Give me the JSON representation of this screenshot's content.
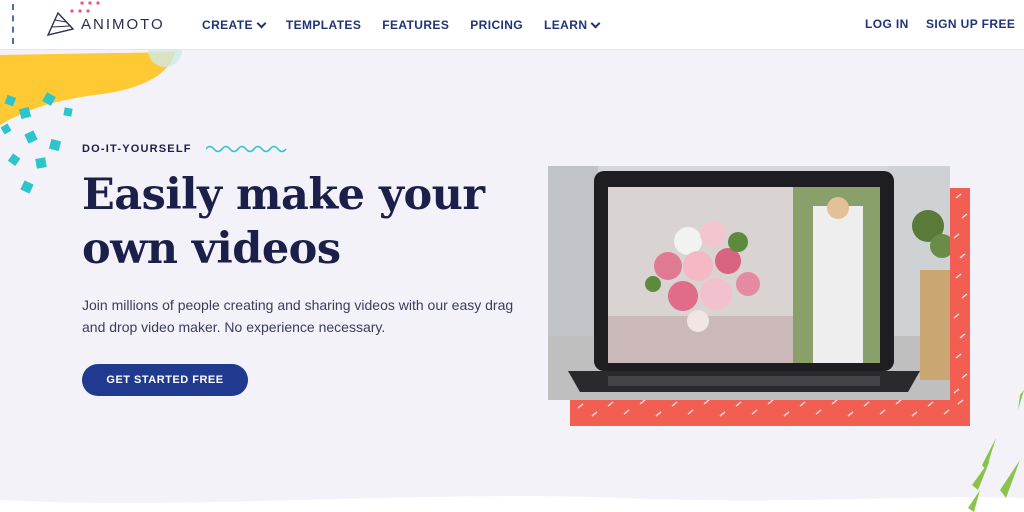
{
  "nav": {
    "logo": "ANIMOTO",
    "links": [
      {
        "label": "CREATE",
        "dropdown": true
      },
      {
        "label": "TEMPLATES",
        "dropdown": false
      },
      {
        "label": "FEATURES",
        "dropdown": false
      },
      {
        "label": "PRICING",
        "dropdown": false
      },
      {
        "label": "LEARN",
        "dropdown": true
      }
    ],
    "login": "LOG IN",
    "signup": "SIGN UP FREE"
  },
  "hero": {
    "eyebrow": "DO-IT-YOURSELF",
    "headline_line1": "Easily make your",
    "headline_line2": "own videos",
    "body": "Join millions of people creating and sharing videos with our easy drag and drop video maker. No experience necessary.",
    "cta": "GET STARTED FREE"
  },
  "colors": {
    "brand_navy": "#1f3a8f",
    "heading": "#1c1f4a",
    "accent_teal": "#2cc5cc",
    "accent_coral": "#f25f52",
    "accent_yellow": "#ffc934",
    "accent_green": "#8bc34a",
    "background": "#f3f2f8"
  }
}
